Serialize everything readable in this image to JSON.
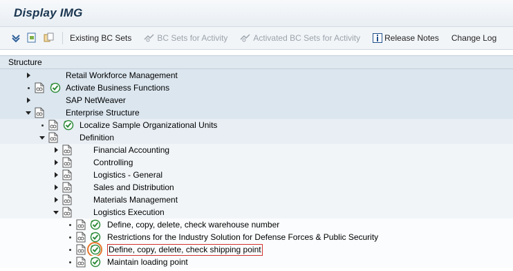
{
  "window": {
    "title": "Display IMG"
  },
  "toolbar": {
    "buttons": [
      {
        "label": "Existing BC Sets",
        "enabled": true
      },
      {
        "label": "BC Sets for Activity",
        "enabled": false
      },
      {
        "label": "Activated BC Sets for Activity",
        "enabled": false
      },
      {
        "label": "Release Notes",
        "enabled": true
      },
      {
        "label": "Change Log",
        "enabled": true
      }
    ]
  },
  "tree": {
    "header": "Structure",
    "rows": [
      {
        "label": "Retail Workforce Management",
        "marker": "collapsed",
        "doc_icon": false,
        "exec_icon": false
      },
      {
        "label": "Activate Business Functions",
        "marker": "leaf",
        "doc_icon": true,
        "exec_icon": true
      },
      {
        "label": "SAP NetWeaver",
        "marker": "collapsed",
        "doc_icon": false,
        "exec_icon": false
      },
      {
        "label": "Enterprise Structure",
        "marker": "expanded",
        "doc_icon": true,
        "exec_icon": false
      },
      {
        "label": "Localize Sample Organizational Units",
        "marker": "leaf",
        "doc_icon": true,
        "exec_icon": true
      },
      {
        "label": "Definition",
        "marker": "expanded",
        "doc_icon": true,
        "exec_icon": false
      },
      {
        "label": "Financial Accounting",
        "marker": "collapsed",
        "doc_icon": true,
        "exec_icon": false
      },
      {
        "label": "Controlling",
        "marker": "collapsed",
        "doc_icon": true,
        "exec_icon": false
      },
      {
        "label": "Logistics - General",
        "marker": "collapsed",
        "doc_icon": true,
        "exec_icon": false
      },
      {
        "label": "Sales and Distribution",
        "marker": "collapsed",
        "doc_icon": true,
        "exec_icon": false
      },
      {
        "label": "Materials Management",
        "marker": "collapsed",
        "doc_icon": true,
        "exec_icon": false
      },
      {
        "label": "Logistics Execution",
        "marker": "expanded",
        "doc_icon": true,
        "exec_icon": false
      },
      {
        "label": "Define, copy, delete, check warehouse number",
        "marker": "leaf",
        "doc_icon": true,
        "exec_icon": true
      },
      {
        "label": "Restrictions for the Industry Solution for Defense Forces & Public Security",
        "marker": "leaf",
        "doc_icon": true,
        "exec_icon": true
      },
      {
        "label": "Define, copy, delete, check shipping point",
        "marker": "leaf",
        "doc_icon": true,
        "exec_icon": true,
        "selected": true
      },
      {
        "label": "Maintain loading point",
        "marker": "leaf",
        "doc_icon": true,
        "exec_icon": true
      }
    ]
  },
  "colors": {
    "highlight_ring": "#e8752a",
    "selection_box": "#d0322e",
    "exec_icon": "#2e8b3a"
  }
}
